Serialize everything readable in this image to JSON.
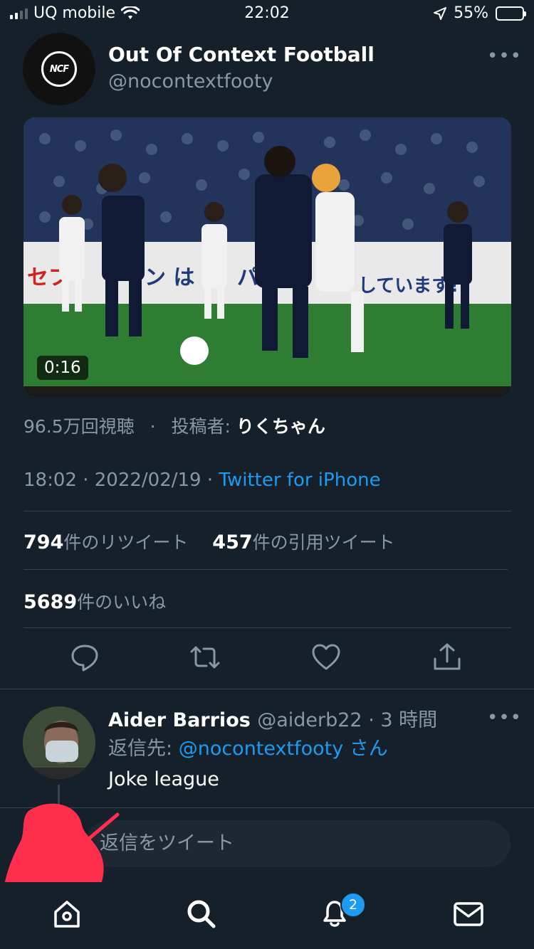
{
  "status_bar": {
    "carrier": "UQ mobile",
    "time": "22:02",
    "battery": "55%",
    "battery_level": 0.55
  },
  "tweet": {
    "author_name": "Out Of Context Football",
    "author_handle": "@nocontextfooty",
    "avatar_text": "NCF",
    "video": {
      "duration": "0:16",
      "billboard_left": "セブ",
      "billboard_mid": "ン は",
      "billboard_mid2": "パ",
      "billboard_right": "しています!"
    },
    "views": "96.5万回視聴",
    "uploader_label": "投稿者:",
    "uploader": "りくちゃん",
    "time": "18:02",
    "date": "2022/02/19",
    "source": "Twitter for iPhone",
    "retweets_count": "794",
    "retweets_label": "件のリツイート",
    "quotes_count": "457",
    "quotes_label": "件の引用ツイート",
    "likes_count": "5689",
    "likes_label": "件のいいね"
  },
  "reply": {
    "name": "Aider Barrios",
    "handle": "@aiderb22",
    "time": "3 時間",
    "reply_to_label": "返信先:",
    "reply_to_mention": "@nocontextfooty",
    "reply_to_suffix": "さん",
    "text": "Joke league"
  },
  "compose": {
    "placeholder": "返信をツイート"
  },
  "tabs": {
    "notifications_badge": "2"
  },
  "colors": {
    "background": "#15202b",
    "accent": "#1d9bf0",
    "secondary_text": "#8899a6",
    "divider": "#38444d"
  }
}
